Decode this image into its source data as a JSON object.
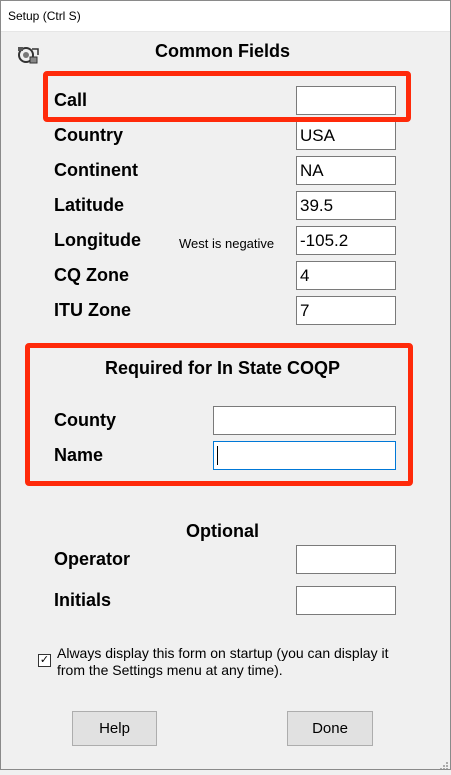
{
  "window": {
    "title": "Setup    (Ctrl S)"
  },
  "colors": {
    "highlight": "#ff2a0a",
    "background": "#f0f0f0",
    "focus": "#0078d7"
  },
  "logo": {
    "icon": "app-logo-icon"
  },
  "common": {
    "heading": "Common Fields",
    "call": {
      "label": "Call",
      "value": ""
    },
    "country": {
      "label": "Country",
      "value": "USA"
    },
    "continent": {
      "label": "Continent",
      "value": "NA"
    },
    "latitude": {
      "label": "Latitude",
      "value": "39.5"
    },
    "longitude": {
      "label": "Longitude",
      "value": "-105.2",
      "hint": "West is negative"
    },
    "cq_zone": {
      "label": "CQ Zone",
      "value": "4"
    },
    "itu_zone": {
      "label": "ITU Zone",
      "value": "7"
    }
  },
  "coqp": {
    "heading": "Required for In State COQP",
    "county": {
      "label": "County",
      "value": ""
    },
    "name": {
      "label": "Name",
      "value": ""
    }
  },
  "optional": {
    "heading": "Optional",
    "operator": {
      "label": "Operator",
      "value": ""
    },
    "initials": {
      "label": "Initials",
      "value": ""
    }
  },
  "startup": {
    "checked": true,
    "mark": "✓",
    "text": "Always display this form on startup (you can display it from the Settings menu at any time)."
  },
  "buttons": {
    "help": "Help",
    "done": "Done"
  }
}
